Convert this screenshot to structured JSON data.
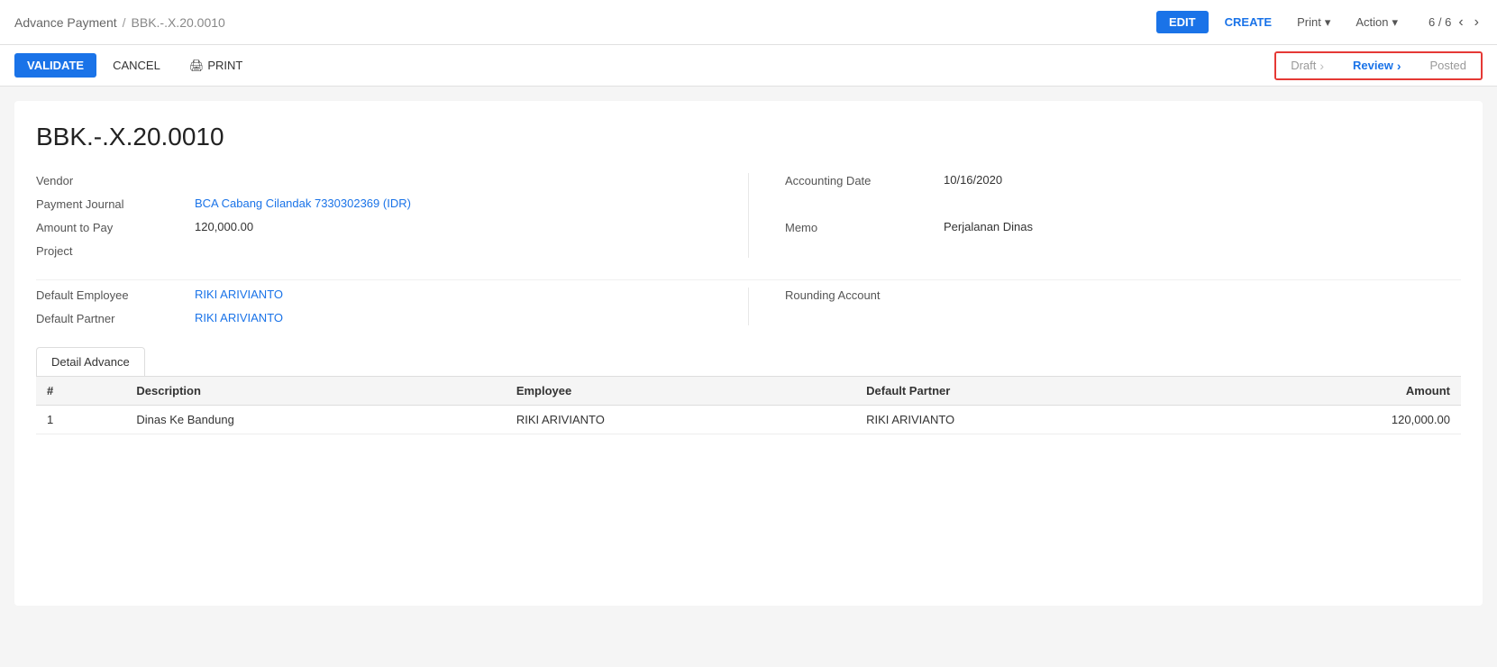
{
  "breadcrumb": {
    "parent": "Advance Payment",
    "separator": "/",
    "current": "BBK.-.X.20.0010"
  },
  "toolbar": {
    "edit_label": "EDIT",
    "create_label": "CREATE",
    "print_label": "Print",
    "action_label": "Action",
    "dropdown_arrow": "▾",
    "pagination_text": "6 / 6",
    "prev_arrow": "‹",
    "next_arrow": "›"
  },
  "action_bar": {
    "validate_label": "VALIDATE",
    "cancel_label": "CANCEL",
    "print_icon": "🖨",
    "print_label": "PRINT"
  },
  "status_bar": {
    "draft_label": "Draft",
    "review_label": "Review",
    "posted_label": "Posted",
    "chevron": "›"
  },
  "document": {
    "title": "BBK.-.X.20.0010",
    "left_fields": [
      {
        "label": "Vendor",
        "value": "",
        "type": "text"
      },
      {
        "label": "Payment Journal",
        "value": "BCA Cabang Cilandak 7330302369 (IDR)",
        "type": "link"
      },
      {
        "label": "Amount to Pay",
        "value": "120,000.00",
        "type": "text"
      },
      {
        "label": "Project",
        "value": "",
        "type": "text"
      }
    ],
    "right_fields": [
      {
        "label": "Accounting Date",
        "value": "10/16/2020",
        "type": "text"
      },
      {
        "label": "Memo",
        "value": "Perjalanan Dinas",
        "type": "text"
      }
    ],
    "left_fields2": [
      {
        "label": "Default Employee",
        "value": "RIKI ARIVIANTO",
        "type": "link"
      },
      {
        "label": "Default Partner",
        "value": "RIKI ARIVIANTO",
        "type": "link"
      }
    ],
    "right_fields2": [
      {
        "label": "Rounding Account",
        "value": "",
        "type": "text"
      }
    ]
  },
  "tab": {
    "label": "Detail Advance"
  },
  "table": {
    "columns": [
      "#",
      "Description",
      "Employee",
      "Default Partner",
      "Amount"
    ],
    "rows": [
      {
        "num": "1",
        "description": "Dinas Ke Bandung",
        "employee": "RIKI ARIVIANTO",
        "partner": "RIKI ARIVIANTO",
        "amount": "120,000.00"
      }
    ]
  }
}
